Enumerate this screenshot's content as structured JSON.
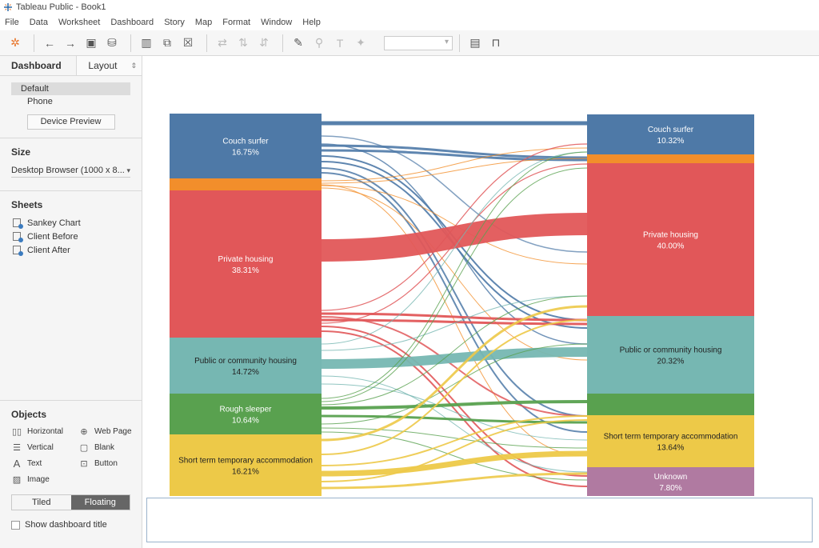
{
  "window": {
    "title": "Tableau Public - Book1"
  },
  "menu": [
    "File",
    "Data",
    "Worksheet",
    "Dashboard",
    "Story",
    "Map",
    "Format",
    "Window",
    "Help"
  ],
  "sidebar": {
    "tabs": {
      "dashboard": "Dashboard",
      "layout": "Layout"
    },
    "devices": {
      "default": "Default",
      "phone": "Phone",
      "preview_button": "Device Preview"
    },
    "size": {
      "heading": "Size",
      "value": "Desktop Browser (1000 x 8..."
    },
    "sheets": {
      "heading": "Sheets",
      "items": [
        "Sankey Chart",
        "Client Before",
        "Client After"
      ]
    },
    "objects": {
      "heading": "Objects",
      "items": [
        "Horizontal",
        "Web Page",
        "Vertical",
        "Blank",
        "Text",
        "Button",
        "Image"
      ]
    },
    "mode": {
      "tiled": "Tiled",
      "floating": "Floating",
      "active": "Floating"
    },
    "show_title": "Show dashboard title"
  },
  "chart_data": {
    "type": "sankey",
    "left": [
      {
        "name": "Couch surfer",
        "pct": "16.75%",
        "color": "#4e79a7"
      },
      {
        "name": "",
        "pct": "",
        "color": "#f28e2b"
      },
      {
        "name": "Private housing",
        "pct": "38.31%",
        "color": "#e15759"
      },
      {
        "name": "Public or community housing",
        "pct": "14.72%",
        "color": "#76b7b2"
      },
      {
        "name": "Rough sleeper",
        "pct": "10.64%",
        "color": "#59a14f"
      },
      {
        "name": "Short term temporary accommodation",
        "pct": "16.21%",
        "color": "#edc948"
      }
    ],
    "right": [
      {
        "name": "Couch surfer",
        "pct": "10.32%",
        "color": "#4e79a7"
      },
      {
        "name": "",
        "pct": "",
        "color": "#f28e2b"
      },
      {
        "name": "Private housing",
        "pct": "40.00%",
        "color": "#e15759"
      },
      {
        "name": "Public or community housing",
        "pct": "20.32%",
        "color": "#76b7b2"
      },
      {
        "name": "",
        "pct": "",
        "color": "#59a14f"
      },
      {
        "name": "Short term temporary accommodation",
        "pct": "13.64%",
        "color": "#edc948"
      },
      {
        "name": "Unknown",
        "pct": "7.80%",
        "color": "#b07aa1"
      }
    ]
  }
}
